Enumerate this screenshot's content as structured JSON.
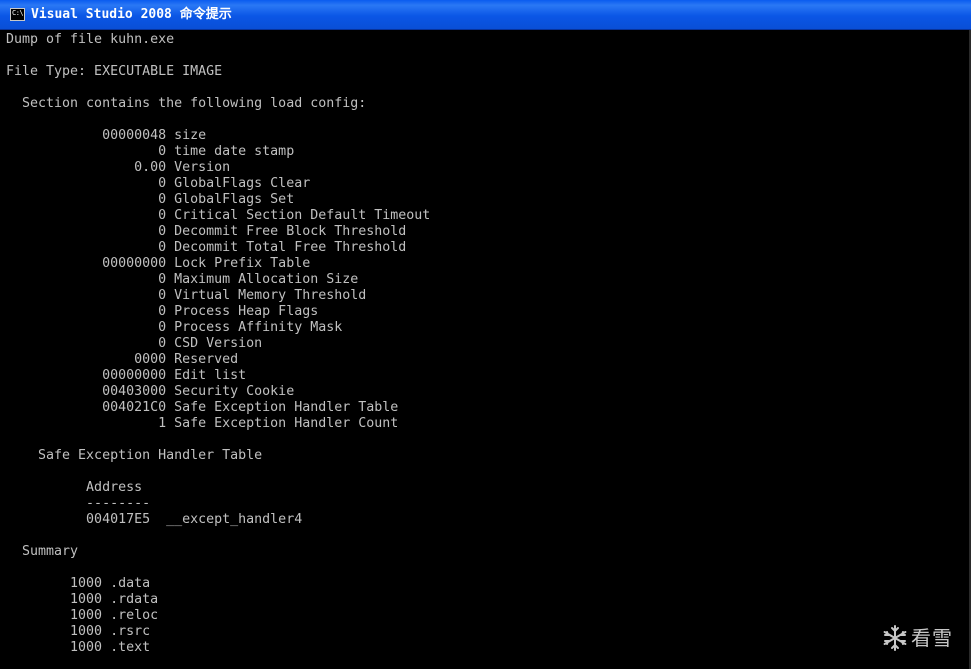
{
  "window": {
    "title": "Visual Studio 2008 命令提示",
    "icon": "console-icon"
  },
  "console": {
    "lines": [
      "Dump of file kuhn.exe",
      "",
      "File Type: EXECUTABLE IMAGE",
      "",
      "  Section contains the following load config:",
      "",
      "            00000048 size",
      "                   0 time date stamp",
      "                0.00 Version",
      "                   0 GlobalFlags Clear",
      "                   0 GlobalFlags Set",
      "                   0 Critical Section Default Timeout",
      "                   0 Decommit Free Block Threshold",
      "                   0 Decommit Total Free Threshold",
      "            00000000 Lock Prefix Table",
      "                   0 Maximum Allocation Size",
      "                   0 Virtual Memory Threshold",
      "                   0 Process Heap Flags",
      "                   0 Process Affinity Mask",
      "                   0 CSD Version",
      "                0000 Reserved",
      "            00000000 Edit list",
      "            00403000 Security Cookie",
      "            004021C0 Safe Exception Handler Table",
      "                   1 Safe Exception Handler Count",
      "",
      "    Safe Exception Handler Table",
      "",
      "          Address",
      "          --------",
      "          004017E5  __except_handler4",
      "",
      "  Summary",
      "",
      "        1000 .data",
      "        1000 .rdata",
      "        1000 .reloc",
      "        1000 .rsrc",
      "        1000 .text"
    ]
  },
  "watermark": {
    "text": "看雪",
    "icon": "snowflake-logo-icon"
  }
}
